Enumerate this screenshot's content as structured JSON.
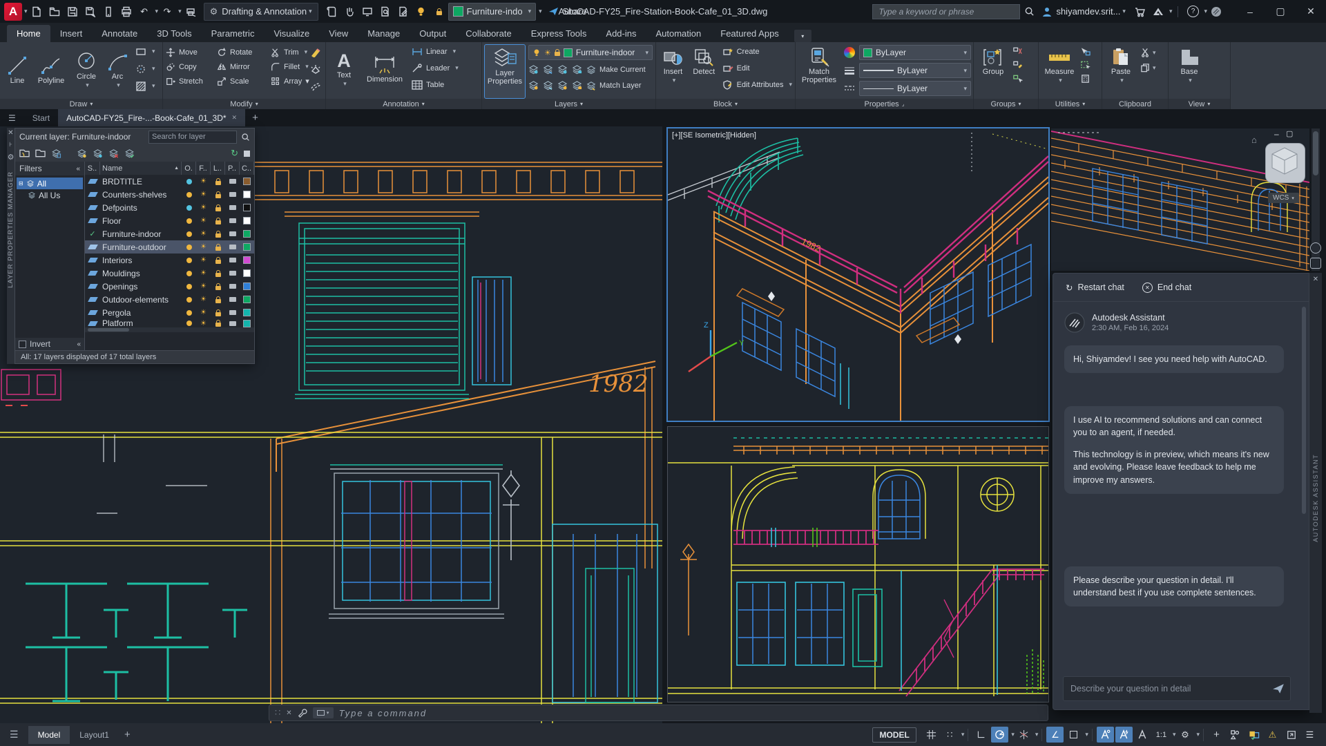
{
  "app": {
    "logo_letter": "A",
    "workspace": "Drafting & Annotation",
    "qat_layer": "Furniture-indo",
    "share_label": "Share",
    "doc_title": "AutoCAD-FY25_Fire-Station-Book-Cafe_01_3D.dwg",
    "search_placeholder": "Type a keyword or phrase",
    "user_name": "shiyamdev.srit..."
  },
  "colors": {
    "accent_blue": "#3f7ec2",
    "active_toggle": "#4d80b8",
    "layer_green": "#0ea862",
    "bulb_on": "#f0b73f",
    "bulb_off": "#53c3e0"
  },
  "ribbon": {
    "tabs": [
      "Home",
      "Insert",
      "Annotate",
      "3D Tools",
      "Parametric",
      "Visualize",
      "View",
      "Manage",
      "Output",
      "Collaborate",
      "Express Tools",
      "Add-ins",
      "Automation",
      "Featured Apps"
    ],
    "panels": {
      "draw": {
        "label": "Draw",
        "line": "Line",
        "polyline": "Polyline",
        "circle": "Circle",
        "arc": "Arc"
      },
      "modify": {
        "label": "Modify",
        "move": "Move",
        "rotate": "Rotate",
        "trim": "Trim",
        "copy": "Copy",
        "mirror": "Mirror",
        "fillet": "Fillet",
        "stretch": "Stretch",
        "scale": "Scale",
        "array": "Array"
      },
      "annotation": {
        "label": "Annotation",
        "text": "Text",
        "dimension": "Dimension",
        "linear": "Linear",
        "leader": "Leader",
        "table": "Table"
      },
      "layers": {
        "label": "Layers",
        "layer_properties": "Layer Properties",
        "combo_value": "Furniture-indoor",
        "make_current": "Make Current",
        "match_layer": "Match Layer"
      },
      "block": {
        "label": "Block",
        "insert": "Insert",
        "detect": "Detect",
        "create": "Create",
        "edit": "Edit",
        "edit_attributes": "Edit Attributes"
      },
      "properties": {
        "label": "Properties",
        "match_properties": "Match Properties",
        "color_value": "ByLayer",
        "lineweight_value": "ByLayer",
        "linetype_value": "ByLayer"
      },
      "groups": {
        "label": "Groups",
        "group": "Group"
      },
      "utilities": {
        "label": "Utilities",
        "measure": "Measure"
      },
      "clipboard": {
        "label": "Clipboard",
        "paste": "Paste"
      },
      "view": {
        "label": "View",
        "base": "Base"
      }
    }
  },
  "file_tabs": {
    "start": "Start",
    "doc": "AutoCAD-FY25_Fire-...-Book-Cafe_01_3D*"
  },
  "layer_palette": {
    "vertical_title": "LAYER PROPERTIES MANAGER",
    "current_layer_text": "Current layer: Furniture-indoor",
    "search_placeholder": "Search for layer",
    "filters_label": "Filters",
    "tree_all": "All",
    "tree_all_used": "All Us",
    "columns": [
      "S..",
      "Name",
      "O.",
      "F..",
      "L..",
      "P..",
      "C.."
    ],
    "invert_label": "Invert",
    "status_text": "All: 17 layers displayed of 17 total layers",
    "layers": [
      {
        "name": "BRDTITLE",
        "bulb": "#53c3e0",
        "swatch": "#8a5c2e"
      },
      {
        "name": "Counters-shelves",
        "bulb": "#f0b73f",
        "swatch": "#ffffff"
      },
      {
        "name": "Defpoints",
        "bulb": "#53c3e0",
        "swatch": "#101010"
      },
      {
        "name": "Floor",
        "bulb": "#f0b73f",
        "swatch": "#ffffff"
      },
      {
        "name": "Furniture-indoor",
        "bulb": "#f0b73f",
        "swatch": "#0ea862"
      },
      {
        "name": "Furniture-outdoor",
        "bulb": "#f0b73f",
        "swatch": "#0ea862"
      },
      {
        "name": "Interiors",
        "bulb": "#f0b73f",
        "swatch": "#d24bd2"
      },
      {
        "name": "Mouldings",
        "bulb": "#f0b73f",
        "swatch": "#ffffff"
      },
      {
        "name": "Openings",
        "bulb": "#f0b73f",
        "swatch": "#2f7fd8"
      },
      {
        "name": "Outdoor-elements",
        "bulb": "#f0b73f",
        "swatch": "#0ea862"
      },
      {
        "name": "Pergola",
        "bulb": "#f0b73f",
        "swatch": "#14b5ad"
      },
      {
        "name": "Platform",
        "bulb": "#f0b73f",
        "swatch": "#14b5ad"
      }
    ]
  },
  "viewports": {
    "top_label": "[+][SE Isometric][Hidden]",
    "wcs": "WCS",
    "year": "1982"
  },
  "assistant": {
    "restart_label": "Restart chat",
    "end_label": "End chat",
    "name": "Autodesk Assistant",
    "timestamp": "2:30 AM, Feb 16, 2024",
    "msg1": "Hi, Shiyamdev! I see you need help with AutoCAD.",
    "msg2a": "I use AI to recommend solutions and can connect you to an agent, if needed.",
    "msg2b": "This technology is in preview, which means it's new and evolving. Please leave feedback to help me improve my answers.",
    "msg3": "Please describe your question in detail. I'll understand best if you use complete sentences.",
    "input_placeholder": "Describe your question in detail",
    "vertical_title": "AUTODESK ASSISTANT"
  },
  "command_line": {
    "placeholder": "Type a command"
  },
  "status_bar": {
    "model_tab": "Model",
    "layout_tab": "Layout1",
    "model_button": "MODEL",
    "scale": "1:1"
  }
}
